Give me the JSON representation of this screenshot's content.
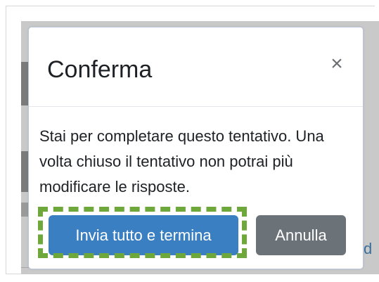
{
  "backdrop": {
    "link_fragment": "d"
  },
  "modal": {
    "title": "Conferma",
    "close_symbol": "×",
    "body_text": "Stai per completare questo tentativo. Una volta chiuso il tentativo non potrai più modificare le risposte.",
    "primary_button_label": "Invia tutto e termina",
    "secondary_button_label": "Annulla"
  },
  "colors": {
    "primary": "#3a7fc1",
    "secondary": "#6b7278",
    "highlight": "#6fa83a"
  },
  "icons": {
    "close": "close-icon"
  }
}
